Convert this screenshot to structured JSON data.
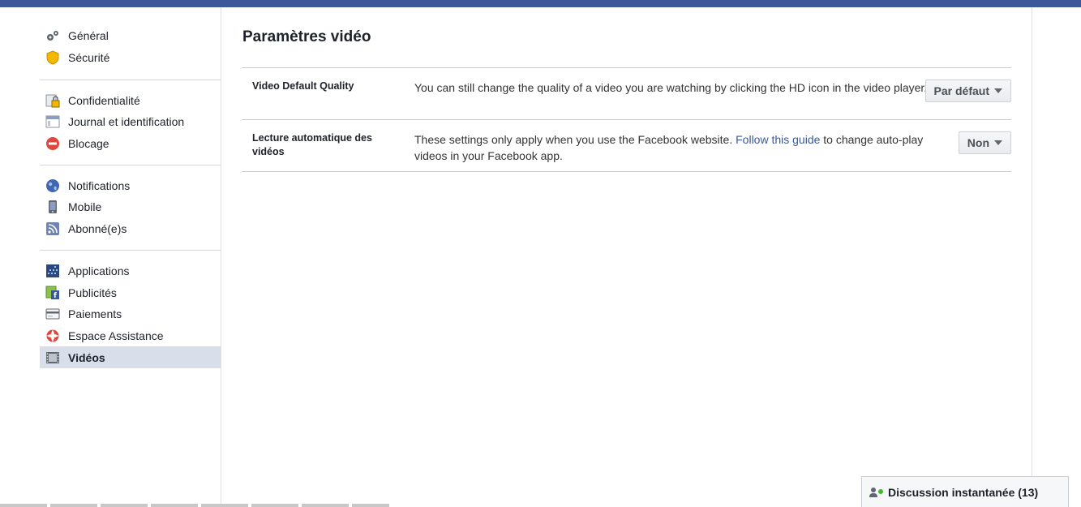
{
  "sidebar": {
    "items": [
      {
        "label": "Général",
        "icon": "gears-icon"
      },
      {
        "label": "Sécurité",
        "icon": "shield-icon"
      },
      {
        "label": "Confidentialité",
        "icon": "lock-icon"
      },
      {
        "label": "Journal et identification",
        "icon": "journal-icon"
      },
      {
        "label": "Blocage",
        "icon": "block-icon"
      },
      {
        "label": "Notifications",
        "icon": "globe-icon"
      },
      {
        "label": "Mobile",
        "icon": "phone-icon"
      },
      {
        "label": "Abonné(e)s",
        "icon": "rss-icon"
      },
      {
        "label": "Applications",
        "icon": "apps-icon"
      },
      {
        "label": "Publicités",
        "icon": "ads-icon"
      },
      {
        "label": "Paiements",
        "icon": "card-icon"
      },
      {
        "label": "Espace Assistance",
        "icon": "lifebuoy-icon"
      },
      {
        "label": "Vidéos",
        "icon": "film-icon",
        "active": true
      }
    ]
  },
  "main": {
    "title": "Paramètres vidéo",
    "rows": [
      {
        "label": "Video Default Quality",
        "description": "You can still change the quality of a video you are watching by clicking the HD icon in the video player.",
        "dropdown": "Par défaut"
      },
      {
        "label": "Lecture automatique des vidéos",
        "description_before": "These settings only apply when you use the Facebook website. ",
        "link": "Follow this guide",
        "description_after": " to change auto-play videos in your Facebook app.",
        "dropdown": "Non"
      }
    ]
  },
  "chat": {
    "label": "Discussion instantanée (13)"
  },
  "colors": {
    "brand": "#3b5998",
    "active_nav": "#d8dfea",
    "online": "#42b72a"
  }
}
